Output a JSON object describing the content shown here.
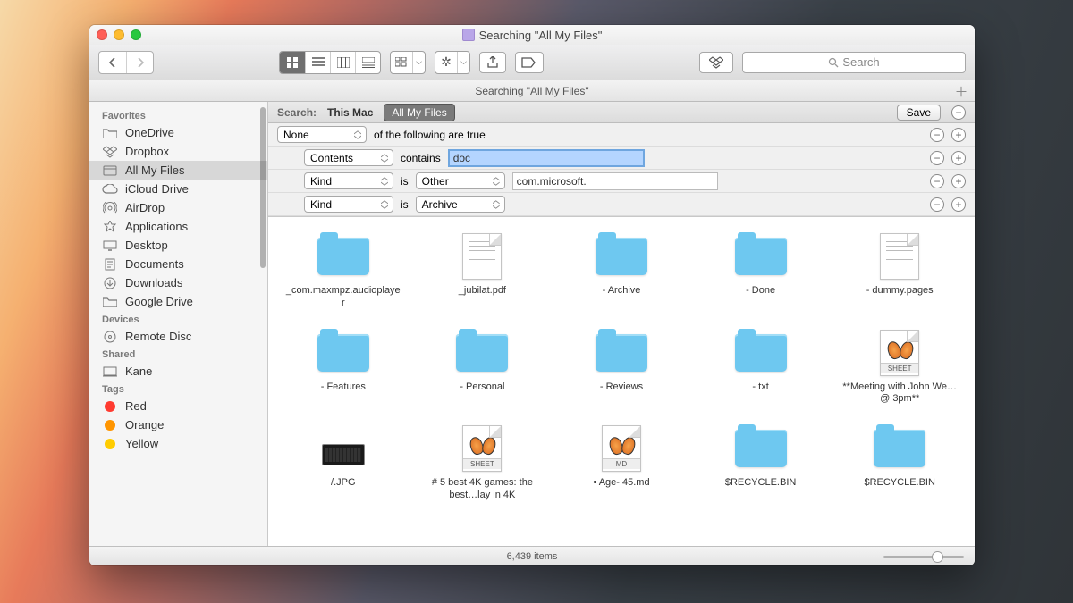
{
  "window": {
    "title": "Searching \"All My Files\""
  },
  "toolbar": {
    "search_placeholder": "Search"
  },
  "tab": {
    "title": "Searching \"All My Files\""
  },
  "sidebar": {
    "sections": [
      {
        "header": "Favorites",
        "items": [
          {
            "icon": "folder",
            "label": "OneDrive"
          },
          {
            "icon": "dropbox",
            "label": "Dropbox"
          },
          {
            "icon": "all",
            "label": "All My Files",
            "selected": true
          },
          {
            "icon": "cloud",
            "label": "iCloud Drive"
          },
          {
            "icon": "airdrop",
            "label": "AirDrop"
          },
          {
            "icon": "apps",
            "label": "Applications"
          },
          {
            "icon": "desktop",
            "label": "Desktop"
          },
          {
            "icon": "docs",
            "label": "Documents"
          },
          {
            "icon": "downloads",
            "label": "Downloads"
          },
          {
            "icon": "folder",
            "label": "Google Drive"
          }
        ]
      },
      {
        "header": "Devices",
        "items": [
          {
            "icon": "disc",
            "label": "Remote Disc"
          }
        ]
      },
      {
        "header": "Shared",
        "items": [
          {
            "icon": "computer",
            "label": "Kane"
          }
        ]
      },
      {
        "header": "Tags",
        "items": [
          {
            "icon": "tag",
            "color": "#ff3b30",
            "label": "Red"
          },
          {
            "icon": "tag",
            "color": "#ff9500",
            "label": "Orange"
          },
          {
            "icon": "tag",
            "color": "#ffcc00",
            "label": "Yellow"
          }
        ]
      }
    ]
  },
  "search": {
    "scope_label": "Search:",
    "scope_options": [
      "This Mac",
      "All My Files"
    ],
    "scope_selected": 1,
    "save_label": "Save",
    "criteria": [
      {
        "indent": 0,
        "field": "None",
        "op_text": "of the following are true"
      },
      {
        "indent": 1,
        "field": "Contents",
        "op": "contains",
        "value": "doc",
        "focused": true
      },
      {
        "indent": 1,
        "field": "Kind",
        "op": "is",
        "value_dd": "Other",
        "value_text": "com.microsoft."
      },
      {
        "indent": 1,
        "field": "Kind",
        "op": "is",
        "value_dd": "Archive"
      }
    ]
  },
  "results": [
    {
      "type": "folder",
      "label": "_com.maxmpz.audioplayer"
    },
    {
      "type": "pdf",
      "label": "_jubilat.pdf"
    },
    {
      "type": "folder",
      "label": "- Archive"
    },
    {
      "type": "folder",
      "label": "- Done"
    },
    {
      "type": "pages",
      "label": "- dummy.pages"
    },
    {
      "type": "folder",
      "label": "- Features"
    },
    {
      "type": "folder",
      "label": "- Personal"
    },
    {
      "type": "folder",
      "label": "- Reviews"
    },
    {
      "type": "folder",
      "label": "- txt"
    },
    {
      "type": "sheet",
      "label": "**Meeting with John We…@ 3pm**"
    },
    {
      "type": "jpg",
      "label": "/.JPG"
    },
    {
      "type": "sheet",
      "label": "# 5 best 4K games: the best…lay in 4K"
    },
    {
      "type": "md",
      "label": "• Age- 45.md"
    },
    {
      "type": "folder",
      "label": "$RECYCLE.BIN"
    },
    {
      "type": "folder",
      "label": "$RECYCLE.BIN"
    }
  ],
  "status": {
    "items": "6,439 items"
  }
}
